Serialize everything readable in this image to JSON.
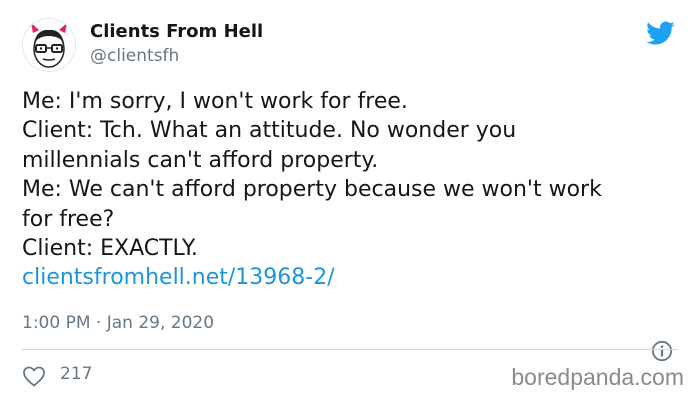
{
  "author": {
    "display_name": "Clients From Hell",
    "handle": "@clientsfh",
    "avatar_icon": "cartoon-face-devil-horns-glasses"
  },
  "tweet": {
    "lines": [
      "Me: I'm sorry, I won't work for free.",
      "Client: Tch. What an attitude. No wonder you",
      "millennials can't afford property.",
      "Me: We can't afford property because we won't work",
      "for free?",
      "Client: EXACTLY."
    ],
    "link": "clientsfromhell.net/13968-2/"
  },
  "meta": {
    "timestamp": "1:00 PM · Jan 29, 2020"
  },
  "stats": {
    "likes": "217"
  },
  "watermark": "boredpanda.com",
  "colors": {
    "twitter_blue": "#1da1f2",
    "link": "#1b95e0",
    "muted": "#657786",
    "text": "#14171a",
    "horns": "#e0245e"
  }
}
